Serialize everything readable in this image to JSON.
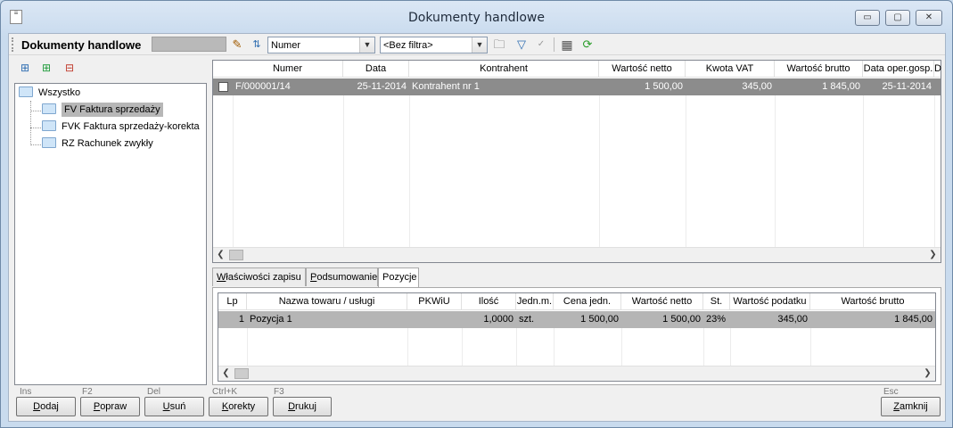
{
  "window": {
    "title": "Dokumenty handlowe",
    "controls": {
      "minimize": "▭",
      "maximize": "▢",
      "close": "✕"
    }
  },
  "toolbar": {
    "title": "Dokumenty handlowe",
    "sort_combo": "Numer",
    "filter_combo": "<Bez filtra>",
    "icons": [
      "clear-filter-icon",
      "sort-icon",
      "folder-icon",
      "filter-icon",
      "check-icon",
      "columns-icon",
      "refresh-icon"
    ]
  },
  "tree": {
    "root": "Wszystko",
    "items": [
      {
        "label": "FV Faktura sprzedaży",
        "selected": true
      },
      {
        "label": "FVK Faktura sprzedaży-korekta",
        "selected": false
      },
      {
        "label": "RZ Rachunek zwykły",
        "selected": false
      }
    ]
  },
  "grid": {
    "columns": [
      "Numer",
      "Data",
      "Kontrahent",
      "Wartość netto",
      "Kwota VAT",
      "Wartość brutto",
      "Data oper.gosp.",
      "D"
    ],
    "rows": [
      [
        "F/000001/14",
        "25-11-2014",
        "Kontrahent nr 1",
        "1 500,00",
        "345,00",
        "1 845,00",
        "25-11-2014"
      ]
    ]
  },
  "tabs": [
    {
      "label": "Właściwości zapisu",
      "accel": "W",
      "rest": "łaściwości zapisu",
      "active": false
    },
    {
      "label": "Podsumowanie",
      "accel": "P",
      "rest": "odsumowanie",
      "active": false
    },
    {
      "label": "Pozycje",
      "accel": "",
      "rest": "Pozycje",
      "active": true
    }
  ],
  "positions": {
    "columns": [
      "Lp",
      "Nazwa towaru / usługi",
      "PKWiU",
      "Ilość",
      "Jedn.m.",
      "Cena jedn.",
      "Wartość netto",
      "St.",
      "Wartość podatku",
      "Wartość brutto"
    ],
    "rows": [
      [
        "1",
        "Pozycja 1",
        "",
        "1,0000",
        "szt.",
        "1 500,00",
        "1 500,00",
        "23%",
        "345,00",
        "1 845,00"
      ]
    ]
  },
  "buttons": [
    {
      "key": "Ins",
      "accel": "D",
      "rest": "odaj"
    },
    {
      "key": "F2",
      "accel": "P",
      "rest": "opraw"
    },
    {
      "key": "Del",
      "accel": "U",
      "rest": "suń"
    },
    {
      "key": "Ctrl+K",
      "accel": "K",
      "rest": "orekty"
    },
    {
      "key": "F3",
      "accel": "D",
      "rest": "rukuj"
    },
    {
      "key": "Esc",
      "accel": "Z",
      "rest": "amknij"
    }
  ]
}
